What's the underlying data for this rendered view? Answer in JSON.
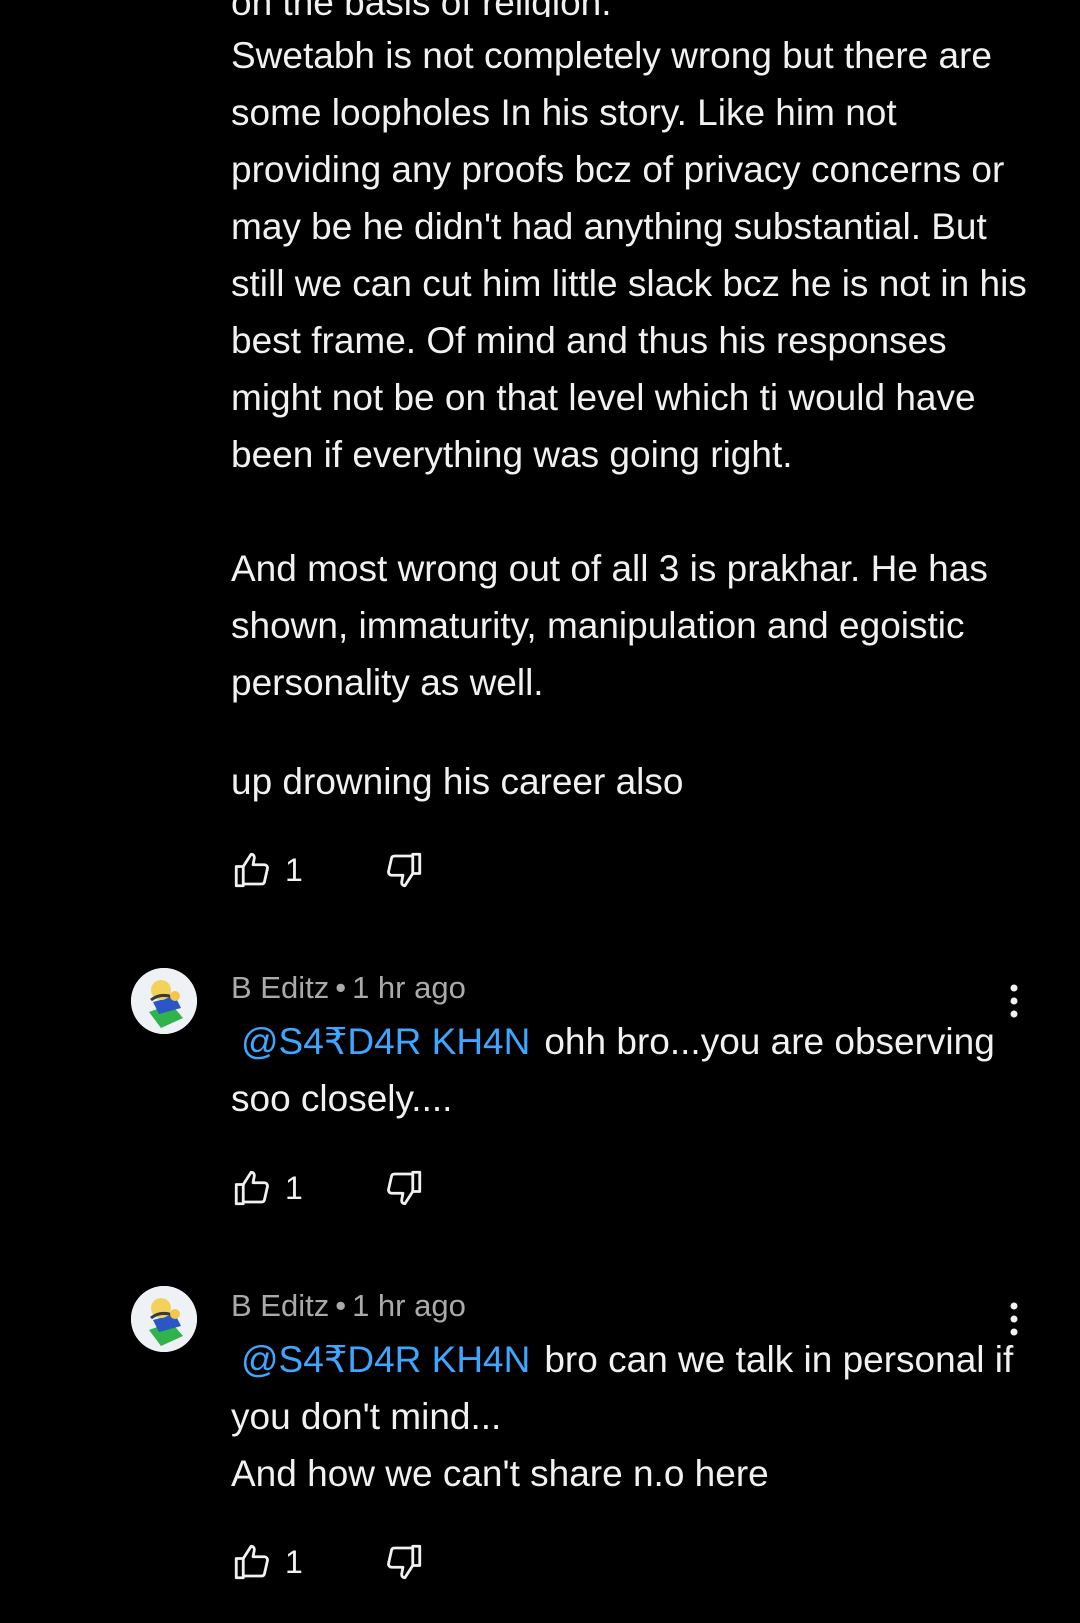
{
  "comment_top": {
    "clipped_line": "on the basis of religion.",
    "paragraph1": "Swetabh is not completely wrong but there are some loopholes In his story. Like him not providing any proofs bcz of privacy concerns or may be he didn't had anything substantial. But still we can cut him little slack bcz he is not in his best frame. Of mind and thus his responses might not be on that level which ti would have been if everything was going right.",
    "paragraph2": "And most wrong out of all 3 is prakhar. He has shown, immaturity, manipulation and egoistic personality as well.",
    "overlap_line": "up drowning his career also",
    "like_count": "1"
  },
  "replies": [
    {
      "author": "B Editz",
      "separator": "•",
      "time": "1 hr ago",
      "mention": "@S4₹D4R KH4N",
      "text": "ohh bro...you are observing soo closely....",
      "like_count": "1"
    },
    {
      "author": "B Editz",
      "separator": "•",
      "time": "1 hr ago",
      "mention": "@S4₹D4R KH4N",
      "text": "bro can we talk in personal if you don't mind...",
      "text2": "And how we can't share n.o here",
      "like_count": "1"
    }
  ],
  "icons": {
    "like": "thumbs-up-icon",
    "dislike": "thumbs-down-icon",
    "more": "more-vertical-icon"
  },
  "colors": {
    "background": "#000000",
    "text": "#f1f1f1",
    "meta": "#aaaaaa",
    "mention": "#3ea6ff"
  }
}
